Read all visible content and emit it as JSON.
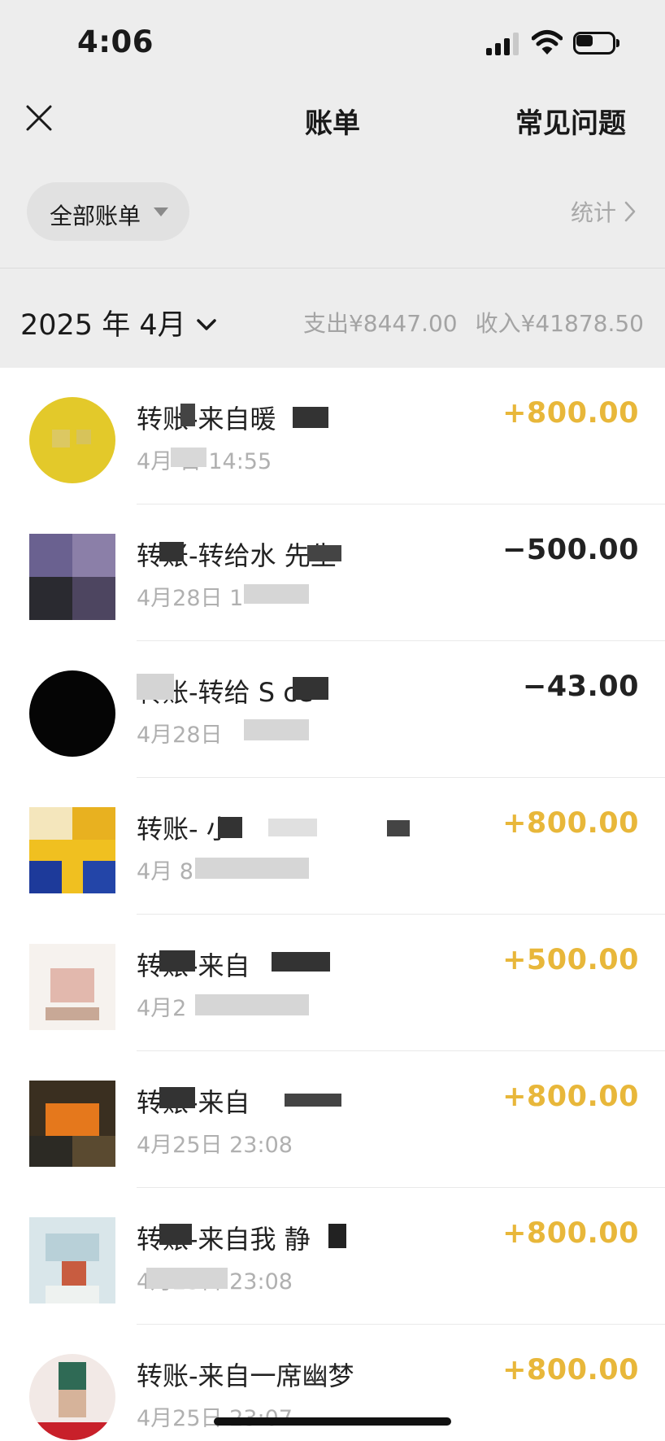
{
  "status_bar": {
    "time": "4:06",
    "icons": [
      "cellular-signal-icon",
      "wifi-icon",
      "battery-icon"
    ],
    "battery_level": 0.45
  },
  "nav": {
    "close_icon": "close-icon",
    "title": "账单",
    "faq_label": "常见问题"
  },
  "filter": {
    "dropdown_label": "全部账单",
    "stats_label": "统计"
  },
  "month_header": {
    "month": "2025 年 4月",
    "expense": "支出¥8447.00",
    "income": "收入¥41878.50"
  },
  "colors": {
    "income_amount": "#e8b73a",
    "expense_amount": "#222222",
    "background": "#ededed"
  },
  "transactions": [
    {
      "title": "转账-来自暖",
      "time": "4月  日 14:55",
      "amount": "+800.00",
      "direction": "in"
    },
    {
      "title": "转账-转给水  先生",
      "time": "4月28日 1",
      "amount": "−500.00",
      "direction": "out"
    },
    {
      "title": "转账-转给 S   ce",
      "time": "4月28日",
      "amount": "−43.00",
      "direction": "out"
    },
    {
      "title": "转账-     小",
      "time": "4月 8",
      "amount": "+800.00",
      "direction": "in"
    },
    {
      "title": "转账-来自",
      "time": "4月2",
      "amount": "+500.00",
      "direction": "in"
    },
    {
      "title": "转账-来自",
      "time": "4月25日 23:08",
      "amount": "+800.00",
      "direction": "in"
    },
    {
      "title": "转账-来自我  静",
      "time": "4月25日 23:08",
      "amount": "+800.00",
      "direction": "in"
    },
    {
      "title": "转账-来自一席幽梦",
      "time": "4月25日 23:07",
      "amount": "+800.00",
      "direction": "in"
    }
  ]
}
